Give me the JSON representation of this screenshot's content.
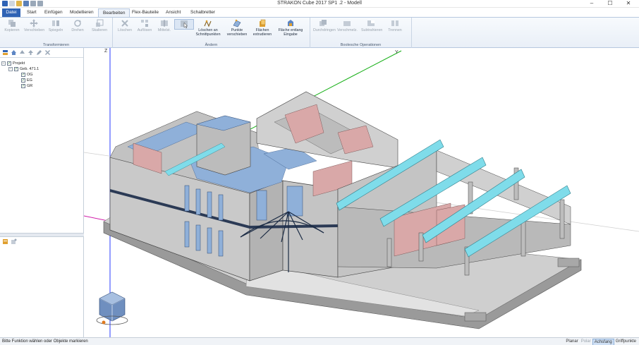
{
  "window": {
    "title": "STRAKON Cube 2017 SP1 .2 - Modell",
    "controls": {
      "minimize": "–",
      "maximize": "☐",
      "close": "✕"
    }
  },
  "ribbon": {
    "tabs": [
      {
        "label": "Datei"
      },
      {
        "label": "Start"
      },
      {
        "label": "Einfügen"
      },
      {
        "label": "Modellieren"
      },
      {
        "label": "Bearbeiten"
      },
      {
        "label": "Flex-Bauteile"
      },
      {
        "label": "Ansicht"
      },
      {
        "label": "Schalbretter"
      }
    ],
    "active_tab": "Bearbeiten",
    "groups": {
      "transform": {
        "label": "Transformieren",
        "buttons": [
          "Kopieren",
          "Verschieben",
          "Spiegeln",
          "Drehen",
          "Skalieren"
        ]
      },
      "change": {
        "label": "Ändern",
        "buttons": [
          "Löschen",
          "Auflösen",
          "Mittelst.",
          "",
          "Löschen an Schnittpunkten",
          "Punkte verschieben",
          "Flächen extrudieren",
          "Fläche entlang Eingabe"
        ]
      },
      "boolean": {
        "label": "Boolesche Operationen",
        "buttons": [
          "Durchdringen",
          "Verschmelz.",
          "Subtrahieren",
          "Trennen"
        ]
      }
    }
  },
  "tree": {
    "items": [
      {
        "label": "Projekt",
        "level": 0
      },
      {
        "label": "Geb. 471.1",
        "level": 1
      },
      {
        "label": "OG",
        "level": 2
      },
      {
        "label": "EG",
        "level": 2
      },
      {
        "label": "GR",
        "level": 2
      }
    ]
  },
  "viewport": {
    "axes": {
      "z": "Z",
      "y": "Y"
    }
  },
  "status": {
    "message": "Bitte Funktion wählen oder Objekte markieren",
    "toggles": [
      {
        "label": "Planar",
        "state": "normal"
      },
      {
        "label": "Polar",
        "state": "off"
      },
      {
        "label": "Achsfang",
        "state": "on"
      },
      {
        "label": "Griffpunkte",
        "state": "normal"
      }
    ]
  },
  "colors": {
    "accent": "#2f63b5",
    "wall": "#c8c8c8",
    "floor": "#8fb0d9",
    "interior_wall": "#d9a8a8",
    "beam": "#7fdcea"
  }
}
